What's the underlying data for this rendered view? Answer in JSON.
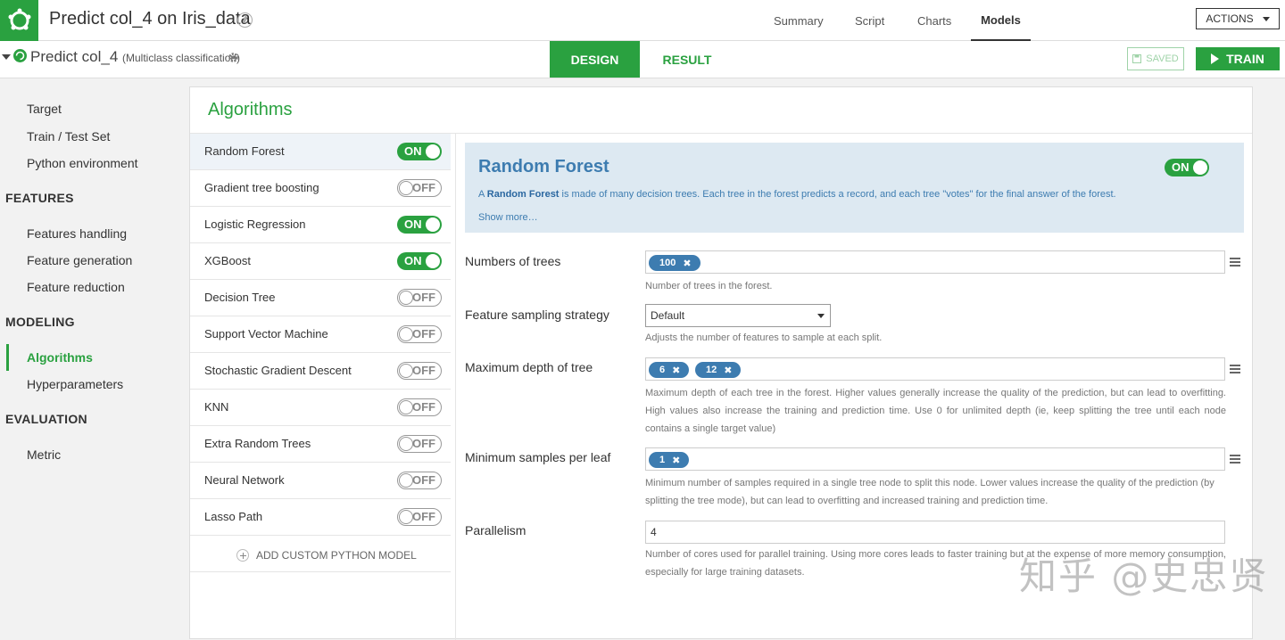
{
  "header": {
    "project_title": "Predict col_4 on Iris_data",
    "nav": [
      "Summary",
      "Script",
      "Charts",
      "Models"
    ],
    "active_nav": "Models",
    "actions_label": "ACTIONS"
  },
  "subheader": {
    "title": "Predict col_4",
    "subtitle": "(Multiclass classification)",
    "tab_design": "DESIGN",
    "tab_result": "RESULT",
    "saved_label": "SAVED",
    "train_label": "TRAIN"
  },
  "sidebar": {
    "items": [
      {
        "label": "Target"
      },
      {
        "label": "Train / Test Set"
      },
      {
        "label": "Python environment"
      }
    ],
    "features_heading": "FEATURES",
    "features_items": [
      {
        "label": "Features handling"
      },
      {
        "label": "Feature generation"
      },
      {
        "label": "Feature reduction"
      }
    ],
    "modeling_heading": "MODELING",
    "modeling_items": [
      {
        "label": "Algorithms"
      },
      {
        "label": "Hyperparameters"
      }
    ],
    "evaluation_heading": "EVALUATION",
    "evaluation_items": [
      {
        "label": "Metric"
      }
    ]
  },
  "panel": {
    "title": "Algorithms",
    "algorithms": [
      {
        "name": "Random Forest",
        "state": "ON"
      },
      {
        "name": "Gradient tree boosting",
        "state": "OFF"
      },
      {
        "name": "Logistic Regression",
        "state": "ON"
      },
      {
        "name": "XGBoost",
        "state": "ON"
      },
      {
        "name": "Decision Tree",
        "state": "OFF"
      },
      {
        "name": "Support Vector Machine",
        "state": "OFF"
      },
      {
        "name": "Stochastic Gradient Descent",
        "state": "OFF"
      },
      {
        "name": "KNN",
        "state": "OFF"
      },
      {
        "name": "Extra Random Trees",
        "state": "OFF"
      },
      {
        "name": "Neural Network",
        "state": "OFF"
      },
      {
        "name": "Lasso Path",
        "state": "OFF"
      }
    ],
    "add_custom_label": "ADD CUSTOM PYTHON MODEL"
  },
  "detail": {
    "title": "Random Forest",
    "toggle": "ON",
    "desc_prefix": "A",
    "desc_bold": "Random Forest",
    "desc_rest": "is made of many decision trees. Each tree in the forest predicts a record, and each tree \"votes\" for the final answer of the forest.",
    "show_more": "Show more…",
    "params": {
      "num_trees": {
        "label": "Numbers of trees",
        "chips": [
          "100"
        ],
        "hint": "Number of trees in the forest."
      },
      "sampling": {
        "label": "Feature sampling strategy",
        "value": "Default",
        "hint": "Adjusts the number of features to sample at each split."
      },
      "max_depth": {
        "label": "Maximum depth of tree",
        "chips": [
          "6",
          "12"
        ],
        "hint": "Maximum depth of each tree in the forest. Higher values generally increase the quality of the prediction, but can lead to overfitting. High values also increase the training and prediction time. Use 0 for unlimited depth (ie, keep splitting the tree until each node contains a single target value)"
      },
      "min_samples": {
        "label": "Minimum samples per leaf",
        "chips": [
          "1"
        ],
        "hint": "Minimum number of samples required in a single tree node to split this node. Lower values increase the quality of the prediction (by splitting the tree mode), but can lead to overfitting and increased training and prediction time."
      },
      "parallelism": {
        "label": "Parallelism",
        "value": "4",
        "hint": "Number of cores used for parallel training. Using more cores leads to faster training but at the expense of more memory consumption, especially for large training datasets."
      }
    }
  },
  "watermark": "知乎 @史忠贤",
  "colors": {
    "accent": "#2aa140",
    "info_blue": "#3d7cb0",
    "card_bg": "#dde9f2"
  }
}
